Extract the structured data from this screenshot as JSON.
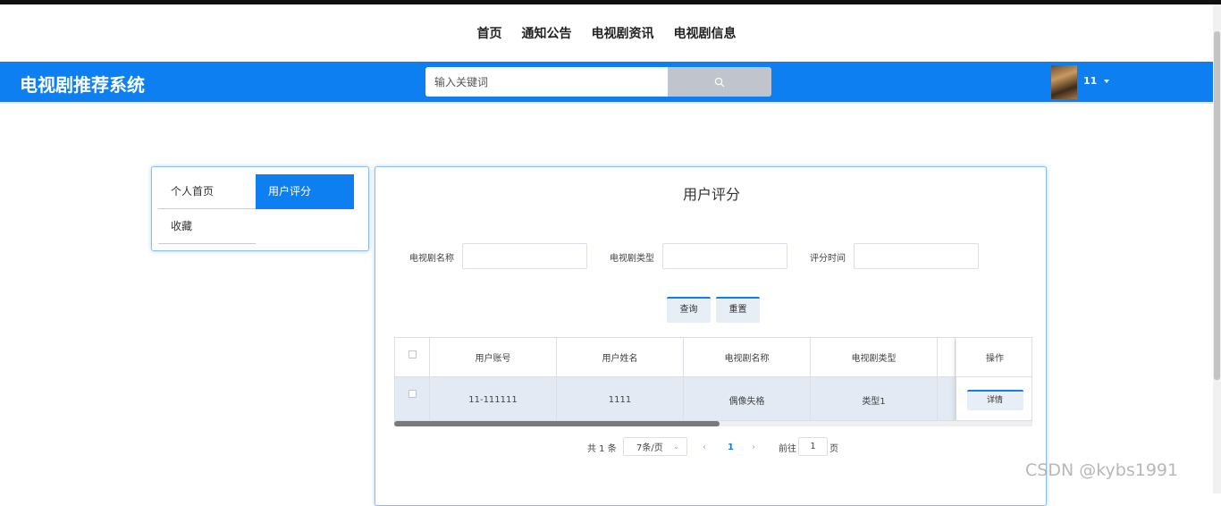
{
  "topnav": {
    "items": [
      "首页",
      "通知公告",
      "电视剧资讯",
      "电视剧信息"
    ]
  },
  "header": {
    "title": "电视剧推荐系统",
    "search_placeholder": "输入关键词",
    "username": "11"
  },
  "sidemenu": {
    "items": [
      "个人首页",
      "用户评分",
      "收藏"
    ],
    "active": "用户评分"
  },
  "panel": {
    "title": "用户评分",
    "filters": [
      {
        "label": "电视剧名称",
        "value": ""
      },
      {
        "label": "电视剧类型",
        "value": ""
      },
      {
        "label": "评分时间",
        "value": ""
      }
    ],
    "query_label": "查询",
    "reset_label": "重置",
    "table": {
      "columns": [
        "用户账号",
        "用户姓名",
        "电视剧名称",
        "电视剧类型"
      ],
      "action_column": "操作",
      "rows": [
        {
          "cells": [
            "11-111111",
            "1111",
            "偶像失格",
            "类型1"
          ],
          "action": "详情"
        }
      ]
    },
    "pagination": {
      "total": "共 1 条",
      "page_size": "7条/页",
      "current_page": "1",
      "goto_prefix": "前往",
      "goto_value": "1",
      "goto_suffix": "页"
    }
  },
  "watermark": "CSDN @kybs1991",
  "colors": {
    "primary": "#0d7ff0",
    "search_button": "#c0c4cc",
    "row_highlight": "#e3eaf3"
  }
}
